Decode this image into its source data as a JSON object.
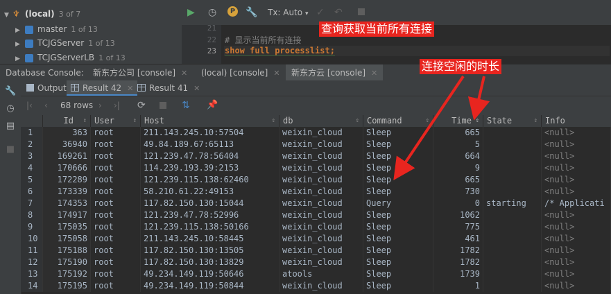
{
  "tree": {
    "root": {
      "label": "(local)",
      "count": "3 of 7"
    },
    "items": [
      {
        "label": "master",
        "count": "1 of 13"
      },
      {
        "label": "TCJGServer",
        "count": "1 of 13"
      },
      {
        "label": "TCJGServerLB",
        "count": "1 of 13"
      }
    ]
  },
  "toolbar": {
    "tx_label": "Tx: Auto",
    "tx_arrow": "▾"
  },
  "editor": {
    "lines": [
      {
        "no": "21",
        "text": ""
      },
      {
        "no": "22",
        "text": "# 显示当前所有连接"
      },
      {
        "no": "23",
        "text": "show full processlist;"
      }
    ]
  },
  "console_bar": {
    "title": "Database Console:",
    "tabs": [
      {
        "label": "新东方公司 [console]",
        "close": "✕"
      },
      {
        "label": "(local) [console]",
        "close": "✕"
      },
      {
        "label": "新东方云 [console]",
        "close": "✕"
      }
    ]
  },
  "result_tabs": [
    {
      "label": "Output"
    },
    {
      "label": "Result 42",
      "close": "✕"
    },
    {
      "label": "Result 41",
      "close": "✕"
    }
  ],
  "result_toolbar": {
    "rows_label": "68 rows"
  },
  "table": {
    "columns": [
      "Id",
      "User",
      "Host",
      "db",
      "Command",
      "Time",
      "State",
      "Info"
    ],
    "rows": [
      [
        "1",
        "363",
        "root",
        "211.143.245.10:57504",
        "weixin_cloud",
        "Sleep",
        "665",
        "",
        "<null>"
      ],
      [
        "2",
        "36940",
        "root",
        "49.84.189.67:65113",
        "weixin_cloud",
        "Sleep",
        "5",
        "",
        "<null>"
      ],
      [
        "3",
        "169261",
        "root",
        "121.239.47.78:56404",
        "weixin_cloud",
        "Sleep",
        "664",
        "",
        "<null>"
      ],
      [
        "4",
        "170666",
        "root",
        "114.239.193.39:2153",
        "weixin_cloud",
        "Sleep",
        "9",
        "",
        "<null>"
      ],
      [
        "5",
        "172289",
        "root",
        "121.239.115.138:62460",
        "weixin_cloud",
        "Sleep",
        "665",
        "",
        "<null>"
      ],
      [
        "6",
        "173339",
        "root",
        "58.210.61.22:49153",
        "weixin_cloud",
        "Sleep",
        "730",
        "",
        "<null>"
      ],
      [
        "7",
        "174353",
        "root",
        "117.82.150.130:15044",
        "weixin_cloud",
        "Query",
        "0",
        "starting",
        "/* Applicati"
      ],
      [
        "8",
        "174917",
        "root",
        "121.239.47.78:52996",
        "weixin_cloud",
        "Sleep",
        "1062",
        "",
        "<null>"
      ],
      [
        "9",
        "175035",
        "root",
        "121.239.115.138:50166",
        "weixin_cloud",
        "Sleep",
        "775",
        "",
        "<null>"
      ],
      [
        "10",
        "175058",
        "root",
        "211.143.245.10:58445",
        "weixin_cloud",
        "Sleep",
        "461",
        "",
        "<null>"
      ],
      [
        "11",
        "175188",
        "root",
        "117.82.150.130:13505",
        "weixin_cloud",
        "Sleep",
        "1782",
        "",
        "<null>"
      ],
      [
        "12",
        "175190",
        "root",
        "117.82.150.130:13829",
        "weixin_cloud",
        "Sleep",
        "1782",
        "",
        "<null>"
      ],
      [
        "13",
        "175192",
        "root",
        "49.234.149.119:50646",
        "atools",
        "Sleep",
        "1739",
        "",
        "<null>"
      ],
      [
        "14",
        "175195",
        "root",
        "49.234.149.119:50844",
        "weixin_cloud",
        "Sleep",
        "1",
        "",
        "<null>"
      ]
    ]
  },
  "annotations": {
    "query_note": "查询获取当前所有连接",
    "idle_note": "连接空闲的时长"
  },
  "colors": {
    "accent": "#4a88c7",
    "annotation": "#e8251f",
    "keyword": "#cc7832",
    "comment": "#808080"
  }
}
